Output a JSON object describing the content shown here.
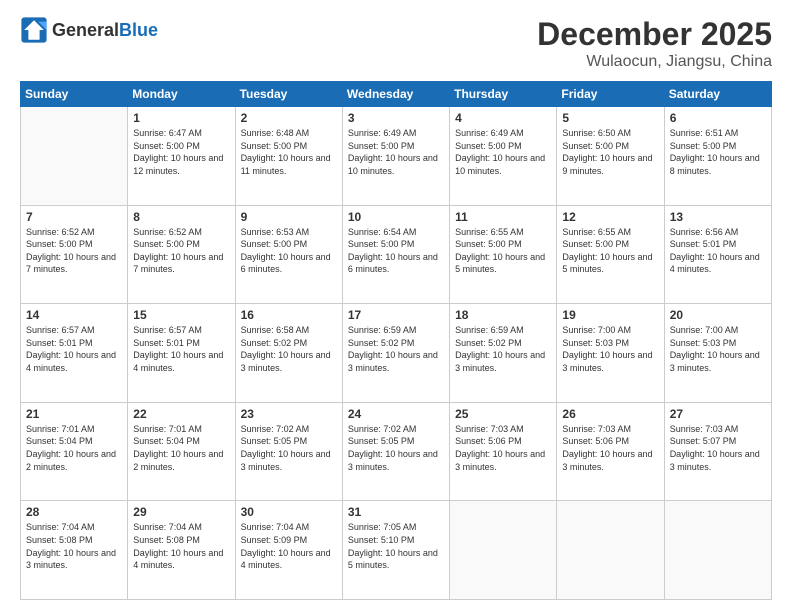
{
  "header": {
    "logo_general": "General",
    "logo_blue": "Blue",
    "month_title": "December 2025",
    "location": "Wulaocun, Jiangsu, China"
  },
  "days_of_week": [
    "Sunday",
    "Monday",
    "Tuesday",
    "Wednesday",
    "Thursday",
    "Friday",
    "Saturday"
  ],
  "weeks": [
    [
      {
        "day": "",
        "empty": true
      },
      {
        "day": "1",
        "sunrise": "6:47 AM",
        "sunset": "5:00 PM",
        "daylight": "10 hours and 12 minutes."
      },
      {
        "day": "2",
        "sunrise": "6:48 AM",
        "sunset": "5:00 PM",
        "daylight": "10 hours and 11 minutes."
      },
      {
        "day": "3",
        "sunrise": "6:49 AM",
        "sunset": "5:00 PM",
        "daylight": "10 hours and 10 minutes."
      },
      {
        "day": "4",
        "sunrise": "6:49 AM",
        "sunset": "5:00 PM",
        "daylight": "10 hours and 10 minutes."
      },
      {
        "day": "5",
        "sunrise": "6:50 AM",
        "sunset": "5:00 PM",
        "daylight": "10 hours and 9 minutes."
      },
      {
        "day": "6",
        "sunrise": "6:51 AM",
        "sunset": "5:00 PM",
        "daylight": "10 hours and 8 minutes."
      }
    ],
    [
      {
        "day": "7",
        "sunrise": "6:52 AM",
        "sunset": "5:00 PM",
        "daylight": "10 hours and 7 minutes."
      },
      {
        "day": "8",
        "sunrise": "6:52 AM",
        "sunset": "5:00 PM",
        "daylight": "10 hours and 7 minutes."
      },
      {
        "day": "9",
        "sunrise": "6:53 AM",
        "sunset": "5:00 PM",
        "daylight": "10 hours and 6 minutes."
      },
      {
        "day": "10",
        "sunrise": "6:54 AM",
        "sunset": "5:00 PM",
        "daylight": "10 hours and 6 minutes."
      },
      {
        "day": "11",
        "sunrise": "6:55 AM",
        "sunset": "5:00 PM",
        "daylight": "10 hours and 5 minutes."
      },
      {
        "day": "12",
        "sunrise": "6:55 AM",
        "sunset": "5:00 PM",
        "daylight": "10 hours and 5 minutes."
      },
      {
        "day": "13",
        "sunrise": "6:56 AM",
        "sunset": "5:01 PM",
        "daylight": "10 hours and 4 minutes."
      }
    ],
    [
      {
        "day": "14",
        "sunrise": "6:57 AM",
        "sunset": "5:01 PM",
        "daylight": "10 hours and 4 minutes."
      },
      {
        "day": "15",
        "sunrise": "6:57 AM",
        "sunset": "5:01 PM",
        "daylight": "10 hours and 4 minutes."
      },
      {
        "day": "16",
        "sunrise": "6:58 AM",
        "sunset": "5:02 PM",
        "daylight": "10 hours and 3 minutes."
      },
      {
        "day": "17",
        "sunrise": "6:59 AM",
        "sunset": "5:02 PM",
        "daylight": "10 hours and 3 minutes."
      },
      {
        "day": "18",
        "sunrise": "6:59 AM",
        "sunset": "5:02 PM",
        "daylight": "10 hours and 3 minutes."
      },
      {
        "day": "19",
        "sunrise": "7:00 AM",
        "sunset": "5:03 PM",
        "daylight": "10 hours and 3 minutes."
      },
      {
        "day": "20",
        "sunrise": "7:00 AM",
        "sunset": "5:03 PM",
        "daylight": "10 hours and 3 minutes."
      }
    ],
    [
      {
        "day": "21",
        "sunrise": "7:01 AM",
        "sunset": "5:04 PM",
        "daylight": "10 hours and 2 minutes."
      },
      {
        "day": "22",
        "sunrise": "7:01 AM",
        "sunset": "5:04 PM",
        "daylight": "10 hours and 2 minutes."
      },
      {
        "day": "23",
        "sunrise": "7:02 AM",
        "sunset": "5:05 PM",
        "daylight": "10 hours and 3 minutes."
      },
      {
        "day": "24",
        "sunrise": "7:02 AM",
        "sunset": "5:05 PM",
        "daylight": "10 hours and 3 minutes."
      },
      {
        "day": "25",
        "sunrise": "7:03 AM",
        "sunset": "5:06 PM",
        "daylight": "10 hours and 3 minutes."
      },
      {
        "day": "26",
        "sunrise": "7:03 AM",
        "sunset": "5:06 PM",
        "daylight": "10 hours and 3 minutes."
      },
      {
        "day": "27",
        "sunrise": "7:03 AM",
        "sunset": "5:07 PM",
        "daylight": "10 hours and 3 minutes."
      }
    ],
    [
      {
        "day": "28",
        "sunrise": "7:04 AM",
        "sunset": "5:08 PM",
        "daylight": "10 hours and 3 minutes."
      },
      {
        "day": "29",
        "sunrise": "7:04 AM",
        "sunset": "5:08 PM",
        "daylight": "10 hours and 4 minutes."
      },
      {
        "day": "30",
        "sunrise": "7:04 AM",
        "sunset": "5:09 PM",
        "daylight": "10 hours and 4 minutes."
      },
      {
        "day": "31",
        "sunrise": "7:05 AM",
        "sunset": "5:10 PM",
        "daylight": "10 hours and 5 minutes."
      },
      {
        "day": "",
        "empty": true
      },
      {
        "day": "",
        "empty": true
      },
      {
        "day": "",
        "empty": true
      }
    ]
  ]
}
